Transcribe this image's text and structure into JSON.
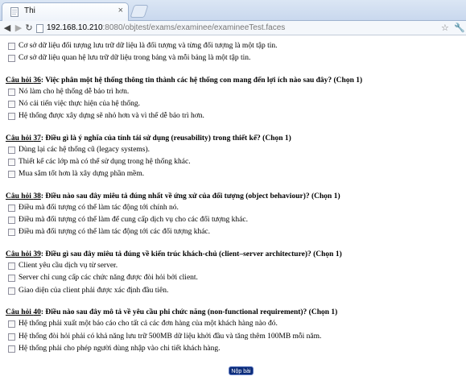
{
  "browser": {
    "tab_title": "Thi",
    "tab_close": "×",
    "url_host": "192.168.10.210",
    "url_path": ":8080/objtest/exams/examinee/examineeTest.faces"
  },
  "prev_options": [
    "Cơ sở dữ liệu đối tượng lưu trữ dữ liệu là đối tượng và từng đối tượng là một tập tin.",
    "Cơ sở dữ liệu quan hệ lưu trữ dữ liệu trong bảng và mỗi bảng là một tập tin."
  ],
  "questions": [
    {
      "label": "Câu hỏi",
      "num": "36",
      "text": ": Việc phân một hệ thống thông tin thành các hệ thống con mang đến lợi ích nào sau đây? (Chọn 1)",
      "options": [
        "Nó làm cho hệ thống dễ bảo trì hơn.",
        "Nó cải tiến việc thực hiện của hệ thống.",
        "Hệ thống được xây dựng sẽ nhỏ hơn và vì thế dễ bảo trì hơn."
      ]
    },
    {
      "label": "Câu hỏi",
      "num": "37",
      "text": ": Điều gì là ý nghĩa của tính tái sử dụng (reusability) trong thiết kế? (Chọn 1)",
      "options": [
        "Dùng lại các hệ thống cũ (legacy systems).",
        "Thiết kế các lớp mà có thể sử dụng trong hệ thống khác.",
        "Mua sắm tốt hơn là xây dựng phần mềm."
      ]
    },
    {
      "label": "Câu hỏi",
      "num": "38",
      "text": ": Điều nào sau đây miêu tả đúng nhất về ứng xử của đối tượng (object behaviour)? (Chọn 1)",
      "options": [
        "Điều mà đối tượng có thể làm tác động tới chính nó.",
        "Điều mà đối tượng có thể làm để cung cấp dịch vụ cho các đối tượng khác.",
        "Điều mà đối tượng có thể làm tác động tới các đối tượng khác."
      ]
    },
    {
      "label": "Câu hỏi",
      "num": "39",
      "text": ": Điều gì sau đây miêu tả đúng về kiến trúc khách-chủ (client–server architecture)? (Chọn 1)",
      "options": [
        "Client yêu cầu dịch vụ từ server.",
        "Server chỉ cung cấp các chức năng được đòi hỏi bởi client.",
        "Giao diện của client phải được xác định đầu tiên."
      ]
    },
    {
      "label": "Câu hỏi",
      "num": "40",
      "text": ": Điều nào sau đây mô tả về yêu cầu phi chức năng (non-functional requirement)? (Chọn 1)",
      "options": [
        "Hệ thống phải xuất một báo cáo cho tất cả các đơn hàng của một khách hàng nào đó.",
        "Hệ thống đòi hỏi phải có khả năng lưu trữ 500MB dữ liệu khởi đầu và tăng thêm 100MB mỗi năm.",
        "Hệ thống phải cho phép người dùng nhập vào chi tiết khách hàng."
      ]
    }
  ],
  "submit_label": "Nộp bài"
}
